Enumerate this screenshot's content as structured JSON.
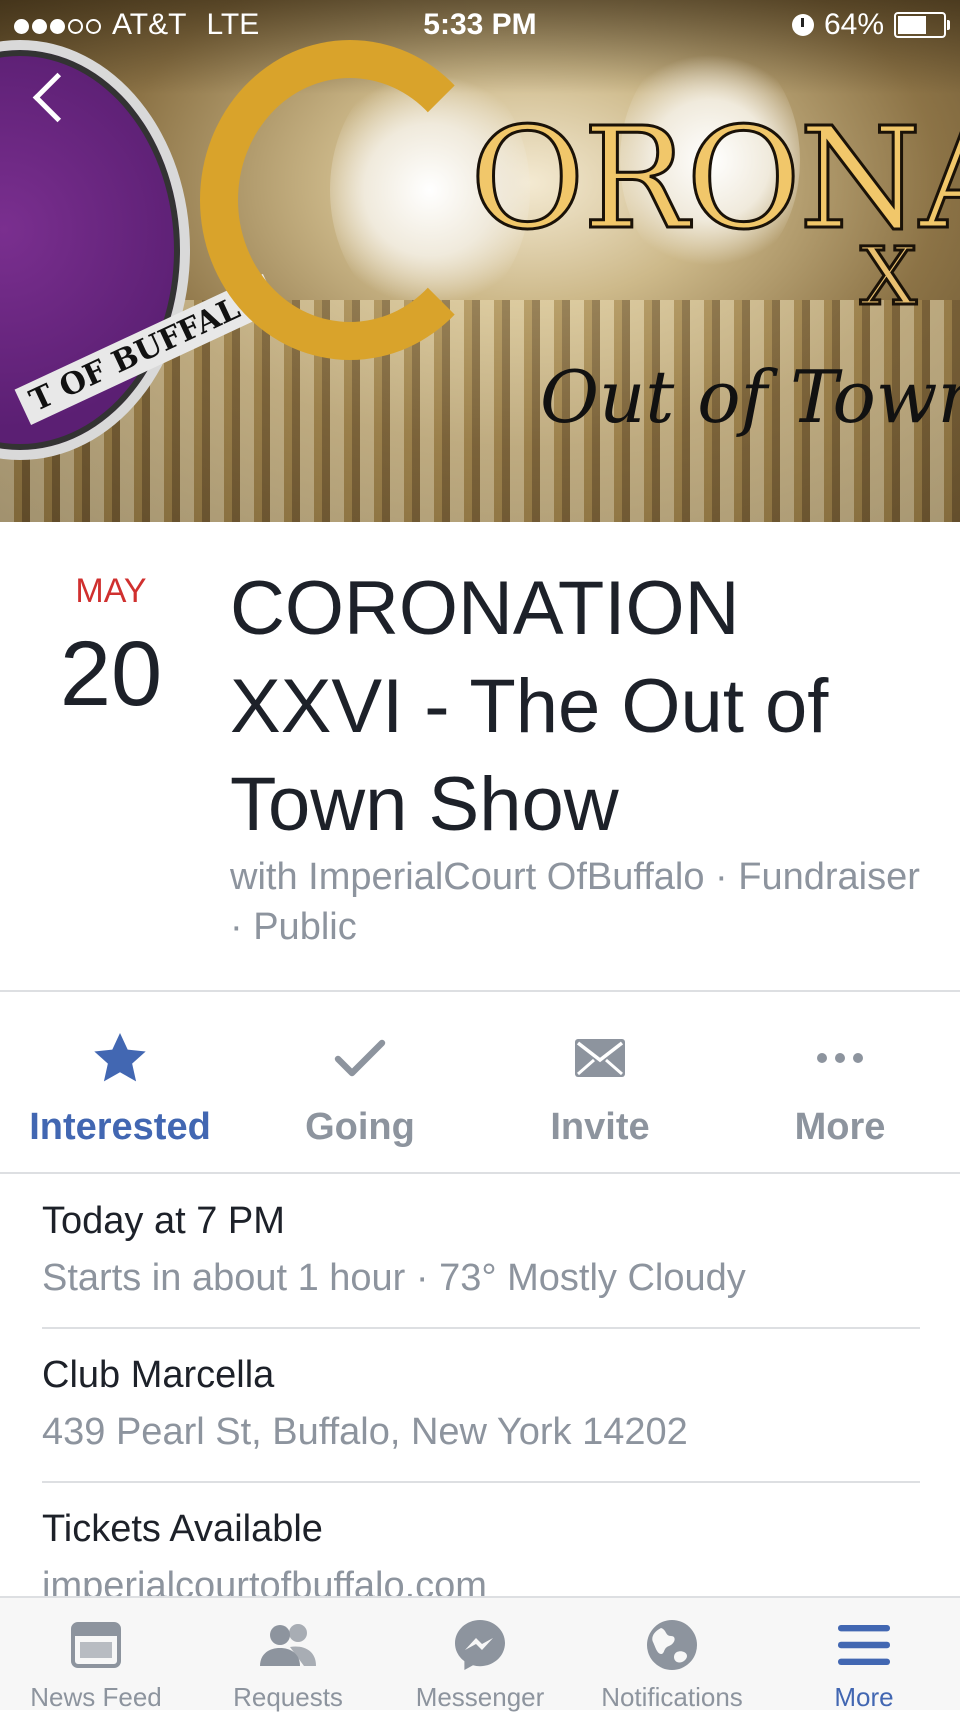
{
  "status_bar": {
    "carrier": "AT&T",
    "network": "LTE",
    "time": "5:33 PM",
    "battery": "64%",
    "battery_level": 0.64,
    "signal_bars": 3
  },
  "cover": {
    "title_text": "ORONAT",
    "roman_text": "X",
    "script_text": "Out of Town",
    "badge_text": "T OF BUFFALO"
  },
  "event": {
    "month": "MAY",
    "day": "20",
    "title": "CORONATION XXVI - The Out of Town Show",
    "subtitle": "with ImperialCourt OfBuffalo · Fundraiser · Public"
  },
  "actions": [
    {
      "label": "Interested",
      "icon": "star-icon",
      "active": true
    },
    {
      "label": "Going",
      "icon": "check-icon",
      "active": false
    },
    {
      "label": "Invite",
      "icon": "envelope-icon",
      "active": false
    },
    {
      "label": "More",
      "icon": "more-dots-icon",
      "active": false
    }
  ],
  "details": {
    "time": {
      "primary": "Today at 7 PM",
      "secondary": "Starts in about 1 hour · 73° Mostly Cloudy"
    },
    "location": {
      "primary": "Club Marcella",
      "secondary": "439 Pearl St, Buffalo, New York 14202"
    },
    "tickets": {
      "primary": "Tickets Available",
      "secondary": "imperialcourtofbuffalo.com"
    }
  },
  "tabbar": [
    {
      "label": "News Feed",
      "icon": "news-feed-icon",
      "active": false
    },
    {
      "label": "Requests",
      "icon": "friend-requests-icon",
      "active": false
    },
    {
      "label": "Messenger",
      "icon": "messenger-icon",
      "active": false
    },
    {
      "label": "Notifications",
      "icon": "globe-icon",
      "active": false
    },
    {
      "label": "More",
      "icon": "menu-icon",
      "active": true
    }
  ],
  "colors": {
    "accent": "#4267b2",
    "date_red": "#d0302f",
    "secondary_text": "#8d949e"
  }
}
